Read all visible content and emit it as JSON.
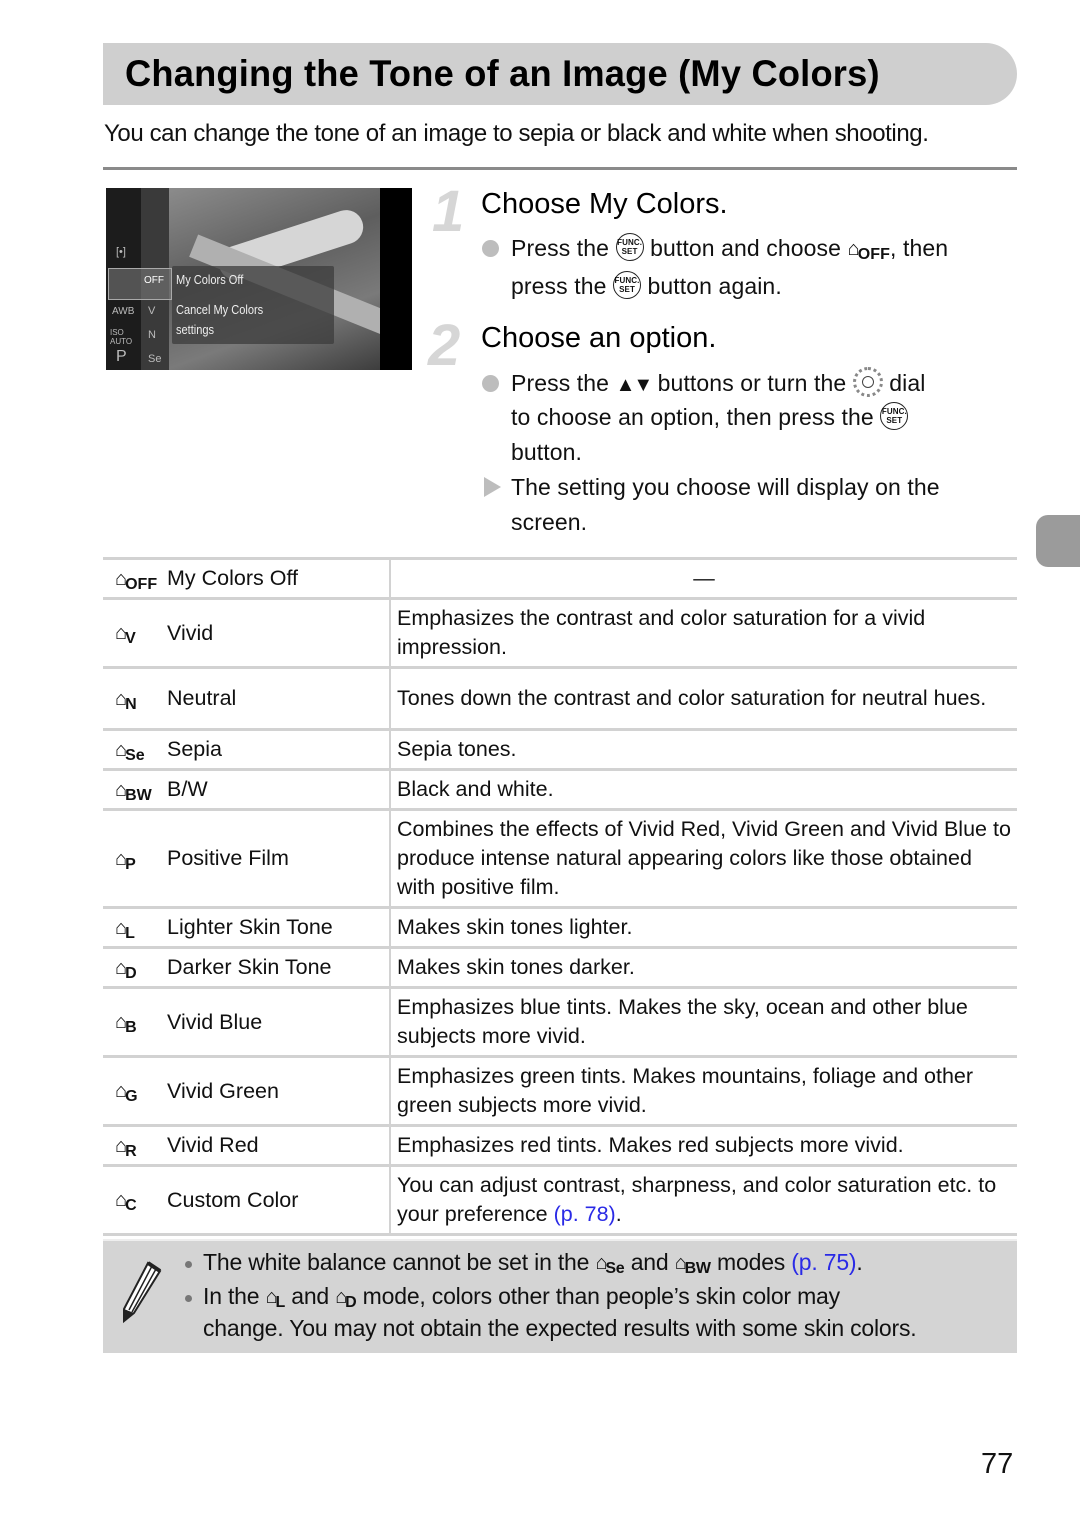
{
  "title": "Changing the Tone of an Image (My Colors)",
  "intro": "You can change the tone of an image to sepia or black and white when shooting.",
  "screenshot": {
    "menu_left_icons": [
      "[•]",
      "AWB",
      "ISO AUTO",
      "P"
    ],
    "menu_options": [
      "OFF",
      "V",
      "N",
      "Se"
    ],
    "selected_label": "My Colors Off",
    "description_line1": "Cancel My Colors",
    "description_line2": "settings"
  },
  "steps": [
    {
      "number": "1",
      "title": "Choose My Colors.",
      "bullets": [
        {
          "type": "action",
          "line1_a": "Press the",
          "line1_b": "button and choose",
          "line1_c": ", then",
          "line2_a": "press the",
          "line2_b": "button again."
        }
      ]
    },
    {
      "number": "2",
      "title": "Choose an option.",
      "bullets": [
        {
          "type": "action",
          "line1_a": "Press the",
          "arrows": "▲▼",
          "line1_b": "buttons or turn the",
          "line1_c": "dial",
          "line2_a": "to choose an option, then press the",
          "line3": "button."
        },
        {
          "type": "result",
          "line1": "The setting you choose will display on the",
          "line2": "screen."
        }
      ]
    }
  ],
  "icons": {
    "func_set_top": "FUNC.",
    "func_set_bottom": "SET"
  },
  "options_table": [
    {
      "icon_suffix": "OFF",
      "name": "My Colors Off",
      "description": "—"
    },
    {
      "icon_suffix": "V",
      "name": "Vivid",
      "description": "Emphasizes the contrast and color saturation for a vivid impression."
    },
    {
      "icon_suffix": "N",
      "name": "Neutral",
      "description": "Tones down the contrast and color saturation for neutral hues."
    },
    {
      "icon_suffix": "Se",
      "name": "Sepia",
      "description": "Sepia tones."
    },
    {
      "icon_suffix": "BW",
      "name": "B/W",
      "description": "Black and white."
    },
    {
      "icon_suffix": "P",
      "name": "Positive Film",
      "description": "Combines the effects of Vivid Red, Vivid Green and Vivid Blue to produce intense natural appearing colors like those obtained with positive film."
    },
    {
      "icon_suffix": "L",
      "name": "Lighter Skin Tone",
      "description": "Makes skin tones lighter."
    },
    {
      "icon_suffix": "D",
      "name": "Darker Skin Tone",
      "description": "Makes skin tones darker."
    },
    {
      "icon_suffix": "B",
      "name": "Vivid Blue",
      "description": "Emphasizes blue tints. Makes the sky, ocean and other blue subjects more vivid."
    },
    {
      "icon_suffix": "G",
      "name": "Vivid Green",
      "description": "Emphasizes green tints. Makes mountains, foliage and other green subjects more vivid."
    },
    {
      "icon_suffix": "R",
      "name": "Vivid Red",
      "description": "Emphasizes red tints. Makes red subjects more vivid."
    },
    {
      "icon_suffix": "C",
      "name": "Custom Color",
      "description": "You can adjust contrast, sharpness, and color saturation etc. to your preference",
      "link": "(p. 78)",
      "after_link": "."
    }
  ],
  "notes": {
    "note1_a": "The white balance cannot be set in the",
    "note1_icon1": "Se",
    "note1_b": "and",
    "note1_icon2": "BW",
    "note1_c": "modes",
    "note1_link": "(p. 75)",
    "note1_end": ".",
    "note2_a": "In the",
    "note2_icon1": "L",
    "note2_b": "and",
    "note2_icon2": "D",
    "note2_c": "mode, colors other than people’s skin color may",
    "note2_line2": "change. You may not obtain the expected results with some skin colors."
  },
  "page_number": "77",
  "colors": {
    "link": "#2a2ae6",
    "title_bar": "#cfcfcf",
    "side_tab": "#9b9b9b",
    "note_bg": "#d4d4d4"
  }
}
